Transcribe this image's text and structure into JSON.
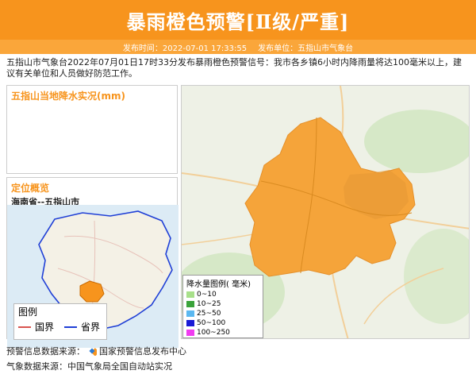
{
  "header": {
    "title": "暴雨橙色预警[Ⅱ级/严重]"
  },
  "meta": {
    "time_label": "发布时间：2022-07-01 17:33:55",
    "unit_label": "发布单位：五指山市气象台"
  },
  "description": "五指山市气象台2022年07月01日17时33分发布暴雨橙色预警信号：我市各乡镇6小时内降雨量将达100毫米以上，建议有关单位和人员做好防范工作。",
  "rain_panel": {
    "title": "五指山当地降水实况(mm)"
  },
  "location_panel": {
    "title": "定位概览",
    "subtitle": "海南省--五指山市",
    "legend": {
      "title": "图例",
      "items": [
        {
          "label": "国界",
          "color": "#d9534f"
        },
        {
          "label": "省界",
          "color": "#1f3fd6"
        }
      ]
    }
  },
  "rain_legend": {
    "title": "降水量图例( 毫米)",
    "items": [
      {
        "label": "0~10",
        "color": "#a8e08a"
      },
      {
        "label": "10~25",
        "color": "#3aa33a"
      },
      {
        "label": "25~50",
        "color": "#5bb8f0"
      },
      {
        "label": "50~100",
        "color": "#1a1ad6"
      },
      {
        "label": "100~250",
        "color": "#f03cf0"
      }
    ]
  },
  "footer": {
    "warning_source": "预警信息数据来源：",
    "warning_source_name": "国家预警信息发布中心",
    "weather_source": "气象数据来源：中国气象局全国自动站实况"
  },
  "colors": {
    "accent": "#f7941d",
    "warning_area": "#f5a43a"
  }
}
